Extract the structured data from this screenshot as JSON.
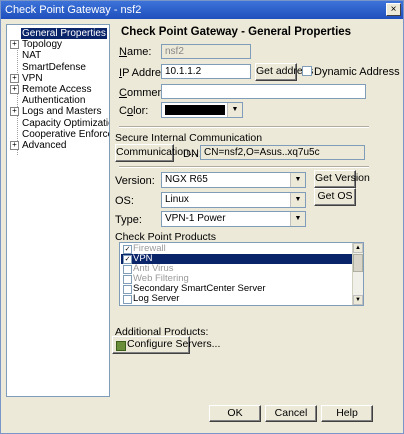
{
  "window": {
    "title": "Check Point Gateway - nsf2",
    "close_glyph": "×"
  },
  "tree": {
    "items": [
      {
        "label": "General Properties",
        "expandable": false,
        "selected": true
      },
      {
        "label": "Topology",
        "expandable": true,
        "selected": false
      },
      {
        "label": "NAT",
        "expandable": false,
        "selected": false
      },
      {
        "label": "SmartDefense",
        "expandable": false,
        "selected": false
      },
      {
        "label": "VPN",
        "expandable": true,
        "selected": false
      },
      {
        "label": "Remote Access",
        "expandable": true,
        "selected": false
      },
      {
        "label": "Authentication",
        "expandable": false,
        "selected": false
      },
      {
        "label": "Logs and Masters",
        "expandable": true,
        "selected": false
      },
      {
        "label": "Capacity Optimization",
        "expandable": false,
        "selected": false
      },
      {
        "label": "Cooperative Enforcem",
        "expandable": false,
        "selected": false
      },
      {
        "label": "Advanced",
        "expandable": true,
        "selected": false
      }
    ]
  },
  "general": {
    "heading": "Check Point Gateway - General Properties",
    "name_label": "Name:",
    "name_value": "nsf2",
    "ip_label": "IP Address:",
    "ip_value": "10.1.1.2",
    "get_address_label": "Get address",
    "dynamic_address_label": "Dynamic Address",
    "comment_label": "Comment:",
    "comment_value": "",
    "color_label": "Color:",
    "color_value": "#000000"
  },
  "sic": {
    "title": "Secure Internal Communication",
    "communication_button": "Communication...",
    "dn_label": "DN:",
    "dn_value": "CN=nsf2,O=Asus..xq7u5c"
  },
  "platform": {
    "version_label": "Version:",
    "version_value": "NGX R65",
    "get_version_button": "Get Version",
    "os_label": "OS:",
    "os_value": "Linux",
    "get_os_button": "Get OS",
    "type_label": "Type:",
    "type_value": "VPN-1 Power"
  },
  "products": {
    "title": "Check Point Products",
    "items": [
      {
        "label": "Firewall",
        "checked": true,
        "disabled": true,
        "selected": false
      },
      {
        "label": "VPN",
        "checked": true,
        "disabled": false,
        "selected": true
      },
      {
        "label": "Anti Virus",
        "checked": false,
        "disabled": true,
        "selected": false
      },
      {
        "label": "Web Filtering",
        "checked": false,
        "disabled": true,
        "selected": false
      },
      {
        "label": "Secondary SmartCenter Server",
        "checked": false,
        "disabled": false,
        "selected": false
      },
      {
        "label": "Log Server",
        "checked": false,
        "disabled": false,
        "selected": false
      }
    ]
  },
  "additional": {
    "title": "Additional Products:",
    "configure_button": "Configure Servers..."
  },
  "footer": {
    "ok": "OK",
    "cancel": "Cancel",
    "help": "Help"
  }
}
